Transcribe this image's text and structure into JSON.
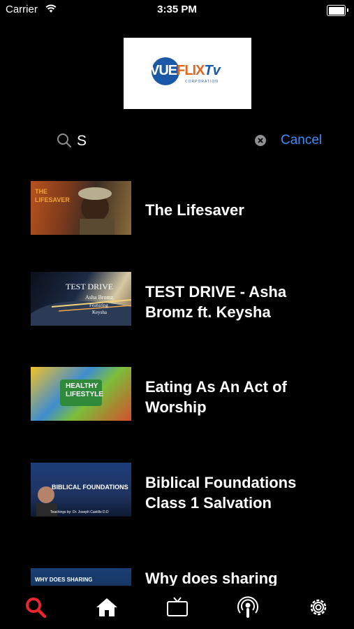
{
  "status_bar": {
    "carrier": "Carrier",
    "time": "3:35 PM"
  },
  "logo": {
    "vue": "VUE",
    "flix": "FLIX",
    "tv": "Tv",
    "corporation": "CORPORATION"
  },
  "search": {
    "value": "S",
    "cancel_label": "Cancel"
  },
  "results": [
    {
      "title_lines": [
        "The Lifesaver"
      ],
      "thumb_text": [
        "THE",
        "LIFESAVER"
      ]
    },
    {
      "title_lines": [
        "TEST DRIVE - Asha",
        "Bromz ft. Keysha"
      ],
      "thumb_text": [
        "TEST DRIVE",
        "Asha Bromz",
        "Featuring",
        "Keysha"
      ]
    },
    {
      "title_lines": [
        "Eating As An Act of",
        "Worship"
      ],
      "thumb_text": [
        "HEALTHY",
        "LIFESTYLE"
      ]
    },
    {
      "title_lines": [
        "Biblical Foundations",
        "Class 1 Salvation"
      ],
      "thumb_text": [
        "BIBLICAL FOUNDATIONS",
        "Teachings by: Dr. Joseph Castillo D.D"
      ]
    },
    {
      "title_lines": [
        "Why does sharing"
      ],
      "thumb_text": [
        "WHY DOES SHARING"
      ]
    }
  ],
  "tab_bar": {
    "items": [
      "search",
      "home",
      "tv",
      "podcast",
      "settings"
    ],
    "active": "search"
  },
  "colors": {
    "accent": "#3f8ef7",
    "active_tab": "#e8262c",
    "background": "#000000"
  }
}
